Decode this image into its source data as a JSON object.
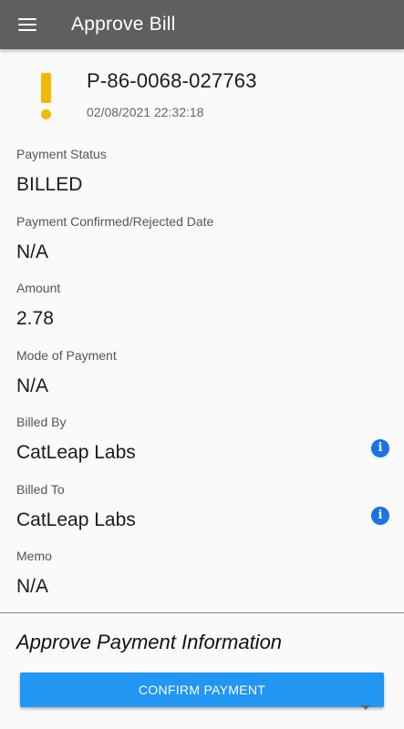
{
  "app_bar": {
    "title": "Approve Bill",
    "menu_icon": "menu-icon"
  },
  "bill": {
    "status_icon": "warning-icon",
    "status_color": "#f5b800",
    "id": "P-86-0068-027763",
    "date": "02/08/2021 22:32:18"
  },
  "fields": {
    "payment_status": {
      "label": "Payment Status",
      "value": "BILLED"
    },
    "confirmed_date": {
      "label": "Payment Confirmed/Rejected Date",
      "value": "N/A"
    },
    "amount": {
      "label": "Amount",
      "value": "2.78"
    },
    "mode": {
      "label": "Mode of Payment",
      "value": "N/A"
    },
    "billed_by": {
      "label": "Billed By",
      "value": "CatLeap Labs",
      "icon": "info-icon"
    },
    "billed_to": {
      "label": "Billed To",
      "value": "CatLeap Labs",
      "icon": "info-icon"
    },
    "memo": {
      "label": "Memo",
      "value": "N/A"
    }
  },
  "approve_section": {
    "title": "Approve Payment Information",
    "confirm_label": "CONFIRM PAYMENT",
    "expand_icon": "chevron-down-icon"
  },
  "colors": {
    "app_bar": "#5f5f5f",
    "accent": "#2196f3",
    "info": "#1a73e8"
  }
}
